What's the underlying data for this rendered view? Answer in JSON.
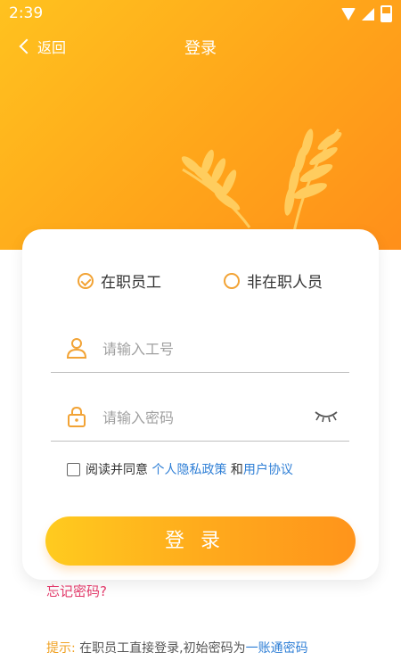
{
  "status_bar": {
    "time": "2:39"
  },
  "nav": {
    "back_label": "返回",
    "title": "登录"
  },
  "role": {
    "option1": "在职员工",
    "option2": "非在职人员",
    "selected": "在职员工"
  },
  "form": {
    "id_placeholder": "请输入工号",
    "password_placeholder": "请输入密码"
  },
  "agreement": {
    "prefix": "阅读并同意",
    "privacy_link": "个人隐私政策",
    "connector": "和",
    "terms_link": "用户协议"
  },
  "login_button": "登录",
  "forgot_password": "忘记密码?",
  "tip": {
    "label": "提示:",
    "text": "在职员工直接登录,初始密码为",
    "link": "一账通密码"
  },
  "colors": {
    "accent": "#ffa51a",
    "link": "#2f7fd6",
    "forgot": "#e23a6a"
  }
}
